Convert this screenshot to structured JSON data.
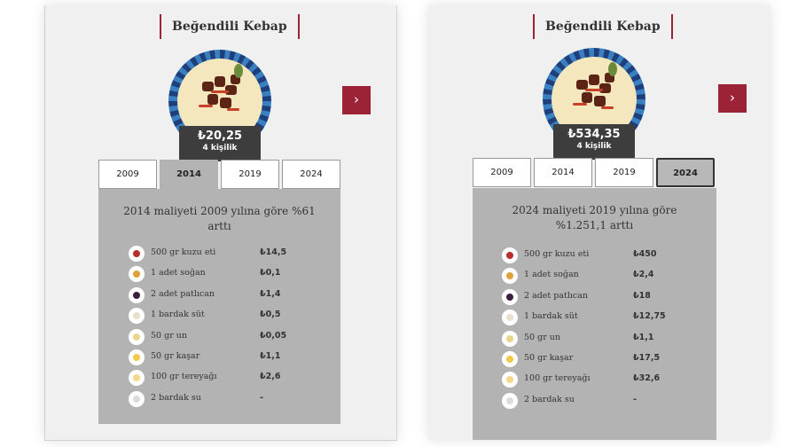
{
  "dish_title": "Beğendili Kebap",
  "next_icon": "›",
  "colors": {
    "accent": "#9b2335",
    "content_bg": "#b3b3b4",
    "price_bg": "#3d3d3d"
  },
  "years": [
    "2009",
    "2014",
    "2019",
    "2024"
  ],
  "left": {
    "selected_year": "2014",
    "price": "₺20,25",
    "servings": "4 kişilik",
    "summary": "2014 maliyeti 2009 yılına göre %61 arttı",
    "ingredients": [
      {
        "icon": "meat-icon",
        "name": "500 gr kuzu eti",
        "cost": "₺14,5"
      },
      {
        "icon": "onion-icon",
        "name": "1 adet soğan",
        "cost": "₺0,1"
      },
      {
        "icon": "eggplant-icon",
        "name": "2 adet patlıcan",
        "cost": "₺1,4"
      },
      {
        "icon": "milk-icon",
        "name": "1 bardak süt",
        "cost": "₺0,5"
      },
      {
        "icon": "flour-icon",
        "name": "50 gr un",
        "cost": "₺0,05"
      },
      {
        "icon": "cheese-icon",
        "name": "50 gr kaşar",
        "cost": "₺1,1"
      },
      {
        "icon": "butter-icon",
        "name": "100 gr tereyağı",
        "cost": "₺2,6"
      },
      {
        "icon": "water-icon",
        "name": "2 bardak su",
        "cost": "-"
      }
    ]
  },
  "right": {
    "selected_year": "2024",
    "price": "₺534,35",
    "servings": "4 kişilik",
    "summary": "2024 maliyeti 2019 yılına göre %1.251,1 arttı",
    "ingredients": [
      {
        "icon": "meat-icon",
        "name": "500 gr kuzu eti",
        "cost": "₺450"
      },
      {
        "icon": "onion-icon",
        "name": "1 adet soğan",
        "cost": "₺2,4"
      },
      {
        "icon": "eggplant-icon",
        "name": "2 adet patlıcan",
        "cost": "₺18"
      },
      {
        "icon": "milk-icon",
        "name": "1 bardak süt",
        "cost": "₺12,75"
      },
      {
        "icon": "flour-icon",
        "name": "50 gr un",
        "cost": "₺1,1"
      },
      {
        "icon": "cheese-icon",
        "name": "50 gr kaşar",
        "cost": "₺17,5"
      },
      {
        "icon": "butter-icon",
        "name": "100 gr tereyağı",
        "cost": "₺32,6"
      },
      {
        "icon": "water-icon",
        "name": "2 bardak su",
        "cost": "-"
      }
    ]
  }
}
